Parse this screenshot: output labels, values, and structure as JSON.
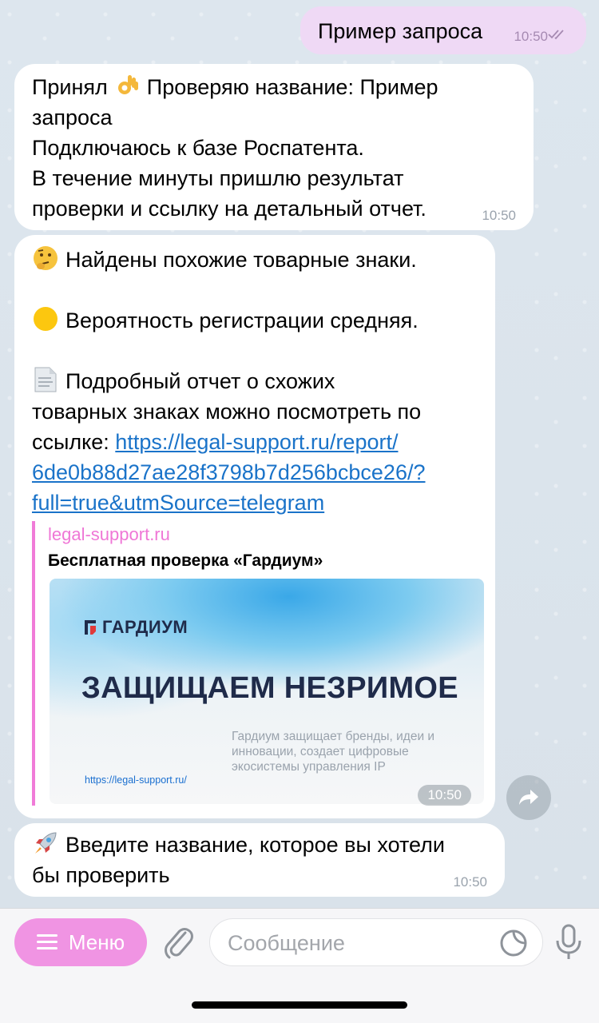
{
  "messages": {
    "outgoing": {
      "text": "Пример запроса",
      "time": "10:50"
    },
    "reply1": {
      "line1_pre": "Принял ",
      "line1_post": " Проверяю название: Пример",
      "line2": "запроса",
      "line3": "Подключаюсь к базе Роспатента.",
      "line4": "В течение минуты пришлю результат",
      "line5": "проверки и ссылку на детальный отчет.",
      "time": "10:50"
    },
    "reply2": {
      "similar_text": "Найдены похожие товарные знаки.",
      "probability_text": "Вероятность регистрации средняя.",
      "report_line1": "Подробный отчет о схожих",
      "report_line2": "товарных знаках можно посмотреть по",
      "report_line3_pre": "ссылке: ",
      "link_line1": "https://legal-support.ru/report/",
      "link_line2": "6de0b88d27ae28f3798b7d256bcbce26/?",
      "link_line3": "full=true&utmSource=telegram",
      "preview": {
        "site": "legal-support.ru",
        "title": "Бесплатная проверка «Гардиум»",
        "image": {
          "brand": "ГАРДИУМ",
          "headline": "ЗАЩИЩАЕМ НЕЗРИМОЕ",
          "tagline": "Гардиум защищает бренды, идеи и инновации, создает цифровые экосистемы управления IP",
          "url": "https://legal-support.ru/"
        }
      },
      "time": "10:50"
    },
    "reply3": {
      "line1": "Введите название, которое вы хотели",
      "line2": "бы проверить",
      "time": "10:50"
    }
  },
  "composer": {
    "menu_label": "Меню",
    "placeholder": "Сообщение"
  },
  "colors": {
    "outgoing_bubble": "#efd9f5",
    "incoming_bubble": "#ffffff",
    "link": "#1a73c9",
    "accent": "#f094e3",
    "preview_bar": "#f07bd8"
  },
  "icons": [
    "ok-hand-emoji",
    "thinking-face-emoji",
    "yellow-circle-emoji",
    "page-emoji",
    "rocket-emoji",
    "double-check-icon",
    "forward-icon",
    "hamburger-icon",
    "paperclip-icon",
    "sticker-icon",
    "microphone-icon"
  ]
}
